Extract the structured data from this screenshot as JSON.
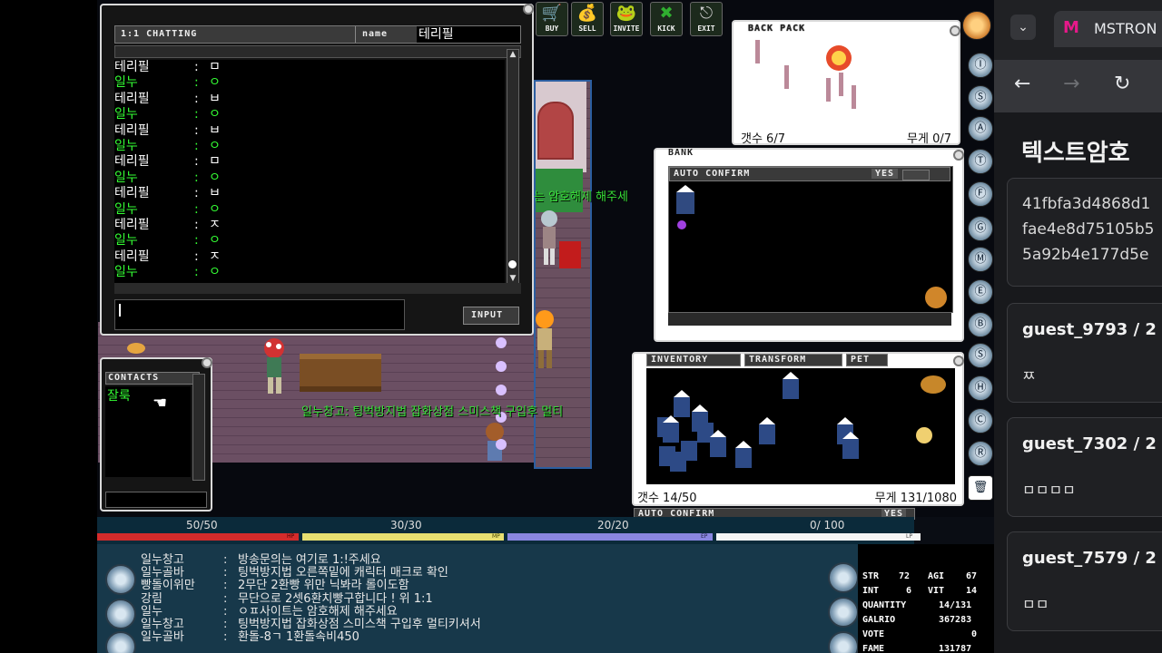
{
  "chat": {
    "title": "1:1 CHATTING",
    "name_label": "name",
    "name_value": "테리필",
    "input_label": "INPUT",
    "messages": [
      {
        "name": "테리필",
        "text": "ㅁ",
        "color": "#ffffff"
      },
      {
        "name": "일누",
        "text": "ㅇ",
        "color": "#34ff34"
      },
      {
        "name": "테리필",
        "text": "ㅂ",
        "color": "#ffffff"
      },
      {
        "name": "일누",
        "text": "ㅇ",
        "color": "#34ff34"
      },
      {
        "name": "테리필",
        "text": "ㅂ",
        "color": "#ffffff"
      },
      {
        "name": "일누",
        "text": "ㅇ",
        "color": "#34ff34"
      },
      {
        "name": "테리필",
        "text": "ㅁ",
        "color": "#ffffff"
      },
      {
        "name": "일누",
        "text": "ㅇ",
        "color": "#34ff34"
      },
      {
        "name": "테리필",
        "text": "ㅂ",
        "color": "#ffffff"
      },
      {
        "name": "일누",
        "text": "ㅇ",
        "color": "#34ff34"
      },
      {
        "name": "테리필",
        "text": "ㅈ",
        "color": "#ffffff"
      },
      {
        "name": "일누",
        "text": "ㅇ",
        "color": "#34ff34"
      },
      {
        "name": "테리필",
        "text": "ㅈ",
        "color": "#ffffff"
      },
      {
        "name": "일누",
        "text": "ㅇ",
        "color": "#34ff34"
      }
    ]
  },
  "toolbar": {
    "buttons": [
      {
        "label": "BUY",
        "icon": "cart-icon"
      },
      {
        "label": "SELL",
        "icon": "moneybag-icon"
      },
      {
        "label": "INVITE",
        "icon": "frog-icon"
      },
      {
        "label": "KICK",
        "icon": "kick-icon"
      },
      {
        "label": "EXIT",
        "icon": "exit-door-icon"
      }
    ]
  },
  "backpack": {
    "title": "BACK PACK",
    "count": "갯수 6/7",
    "weight": "무게 0/7"
  },
  "bank": {
    "title": "BANK",
    "confirm_label": "AUTO CONFIRM",
    "yes": "YES"
  },
  "inventory": {
    "tabs": [
      "INVENTORY",
      "TRANSFORM",
      "PET"
    ],
    "count": "갯수 14/50",
    "weight": "무게 131/1080",
    "auto_confirm": "AUTO CONFIRM",
    "yes": "YES"
  },
  "contacts": {
    "title": "CONTACTS",
    "items": [
      "잘룩"
    ]
  },
  "overlay": {
    "line1": "는 암호해제 해주세",
    "line2": "일누창고: 팅벅방지법 잡화상점 스미스책 구입후 멀티"
  },
  "bars": {
    "hp": "50/50",
    "mp": "30/30",
    "ep": "20/20",
    "lp": "0/ 100",
    "hp_tag": "HP",
    "mp_tag": "MP",
    "ep_tag": "EP",
    "lp_tag": "LP"
  },
  "log": [
    {
      "name": "일누창고",
      "text": "방송문의는 여기로 1:!주세요"
    },
    {
      "name": "일누골바",
      "text": "팅벅방지법 오른쪽밑에 캐릭터 매크로 확인"
    },
    {
      "name": "빵돌이위만",
      "text": "2무단 2환빵 위만 닉봐라 롤이도함"
    },
    {
      "name": "강림",
      "text": "무단으로 2셋6환치빵구합니다 ! 위 1:1"
    },
    {
      "name": "일누",
      "text": "ㅇㅍ사이트는 암호해제 해주세요"
    },
    {
      "name": "일누창고",
      "text": "팅벅방지법 잡화상점 스미스책 구입후 멀티키셔서"
    },
    {
      "name": "일누골바",
      "text": "환돌-8ㄱ 1환돌속비450"
    }
  ],
  "stats": {
    "str_label": "STR",
    "str": "72",
    "agi_label": "AGI",
    "agi": "67",
    "int_label": "INT",
    "int": "6",
    "vit_label": "VIT",
    "vit": "14",
    "quantity_label": "QUANTITY",
    "quantity": "14/131",
    "galrio_label": "GALRIO",
    "galrio": "367283",
    "vote_label": "VOTE",
    "vote": "0",
    "fame_label": "FAME",
    "fame": "131787"
  },
  "browser": {
    "tab_title": "MSTRON",
    "page_title": "텍스트암호",
    "hash_lines": [
      "41fbfa3d4868d1",
      "fae4e8d75105b5",
      "5a92b4e177d5e"
    ],
    "cards": [
      {
        "user": "guest_9793 / 2",
        "text": "ㅉ"
      },
      {
        "user": "guest_7302 / 2",
        "text": "ㅁㅁㅁㅁ"
      },
      {
        "user": "guest_7579 / 2",
        "text": "ㅁㅁ"
      }
    ]
  }
}
